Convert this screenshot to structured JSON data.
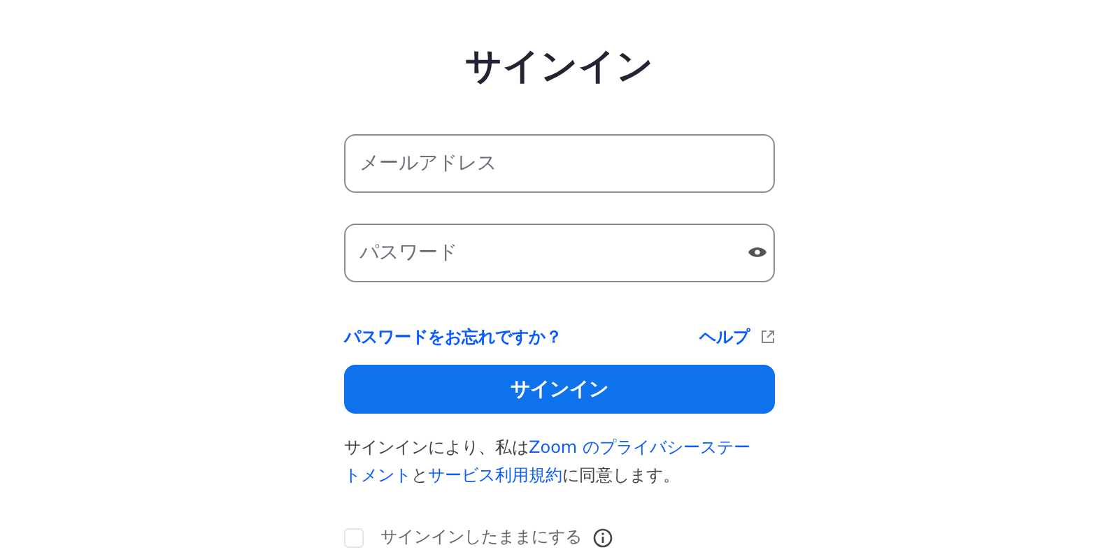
{
  "title": "サインイン",
  "email_field": {
    "placeholder": "メールアドレス"
  },
  "password_field": {
    "placeholder": "パスワード"
  },
  "forgot_link": "パスワードをお忘れですか？",
  "help_link": "ヘルプ",
  "sign_in_button": "サインイン",
  "consent_lines": [
    [
      {
        "kind": "plain",
        "text": "サインインにより、私は"
      },
      {
        "kind": "link",
        "text": "Zoom のプライバシーステー"
      }
    ],
    [
      {
        "kind": "link",
        "text": "トメント"
      },
      {
        "kind": "plain",
        "text": "と"
      },
      {
        "kind": "link",
        "text": "サービス利用規約"
      },
      {
        "kind": "plain",
        "text": "に同意します。"
      }
    ]
  ],
  "stay_signed_in": {
    "label": "サインインしたままにする",
    "checked": false
  }
}
